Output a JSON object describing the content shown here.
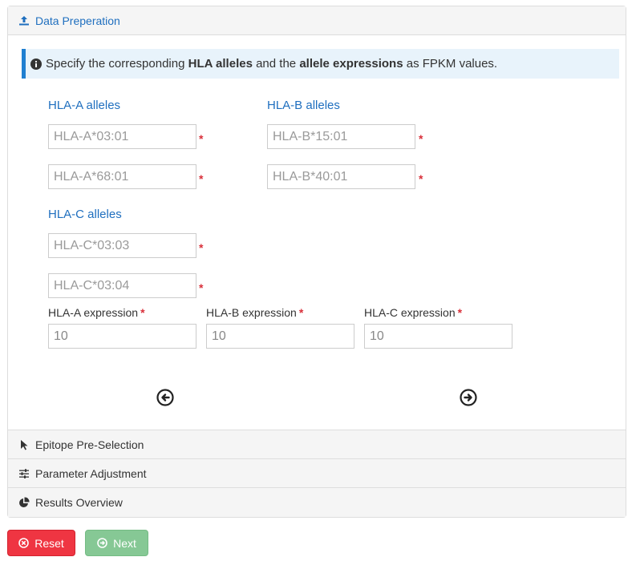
{
  "panels": {
    "data_prep": {
      "title": "Data Preperation"
    },
    "epitope": {
      "title": "Epitope Pre-Selection"
    },
    "parameter": {
      "title": "Parameter Adjustment"
    },
    "results": {
      "title": "Results Overview"
    }
  },
  "info": {
    "prefix": "Specify the corresponding ",
    "bold1": "HLA alleles",
    "mid": " and the ",
    "bold2": "allele expressions",
    "suffix": " as FPKM values."
  },
  "hla_a": {
    "title": "HLA-A alleles",
    "allele1_placeholder": "HLA-A*03:01",
    "allele2_placeholder": "HLA-A*68:01"
  },
  "hla_b": {
    "title": "HLA-B alleles",
    "allele1_placeholder": "HLA-B*15:01",
    "allele2_placeholder": "HLA-B*40:01"
  },
  "hla_c": {
    "title": "HLA-C alleles",
    "allele1_placeholder": "HLA-C*03:03",
    "allele2_placeholder": "HLA-C*03:04"
  },
  "required_marker": "*",
  "expression": {
    "a": {
      "label": "HLA-A expression",
      "value": "10"
    },
    "b": {
      "label": "HLA-B expression",
      "value": "10"
    },
    "c": {
      "label": "HLA-C expression",
      "value": "10"
    }
  },
  "buttons": {
    "reset": "Reset",
    "next": "Next"
  },
  "colors": {
    "accent": "#1f6fbf",
    "danger": "#ef3542",
    "success": "#86c895",
    "required": "#d9303a"
  }
}
